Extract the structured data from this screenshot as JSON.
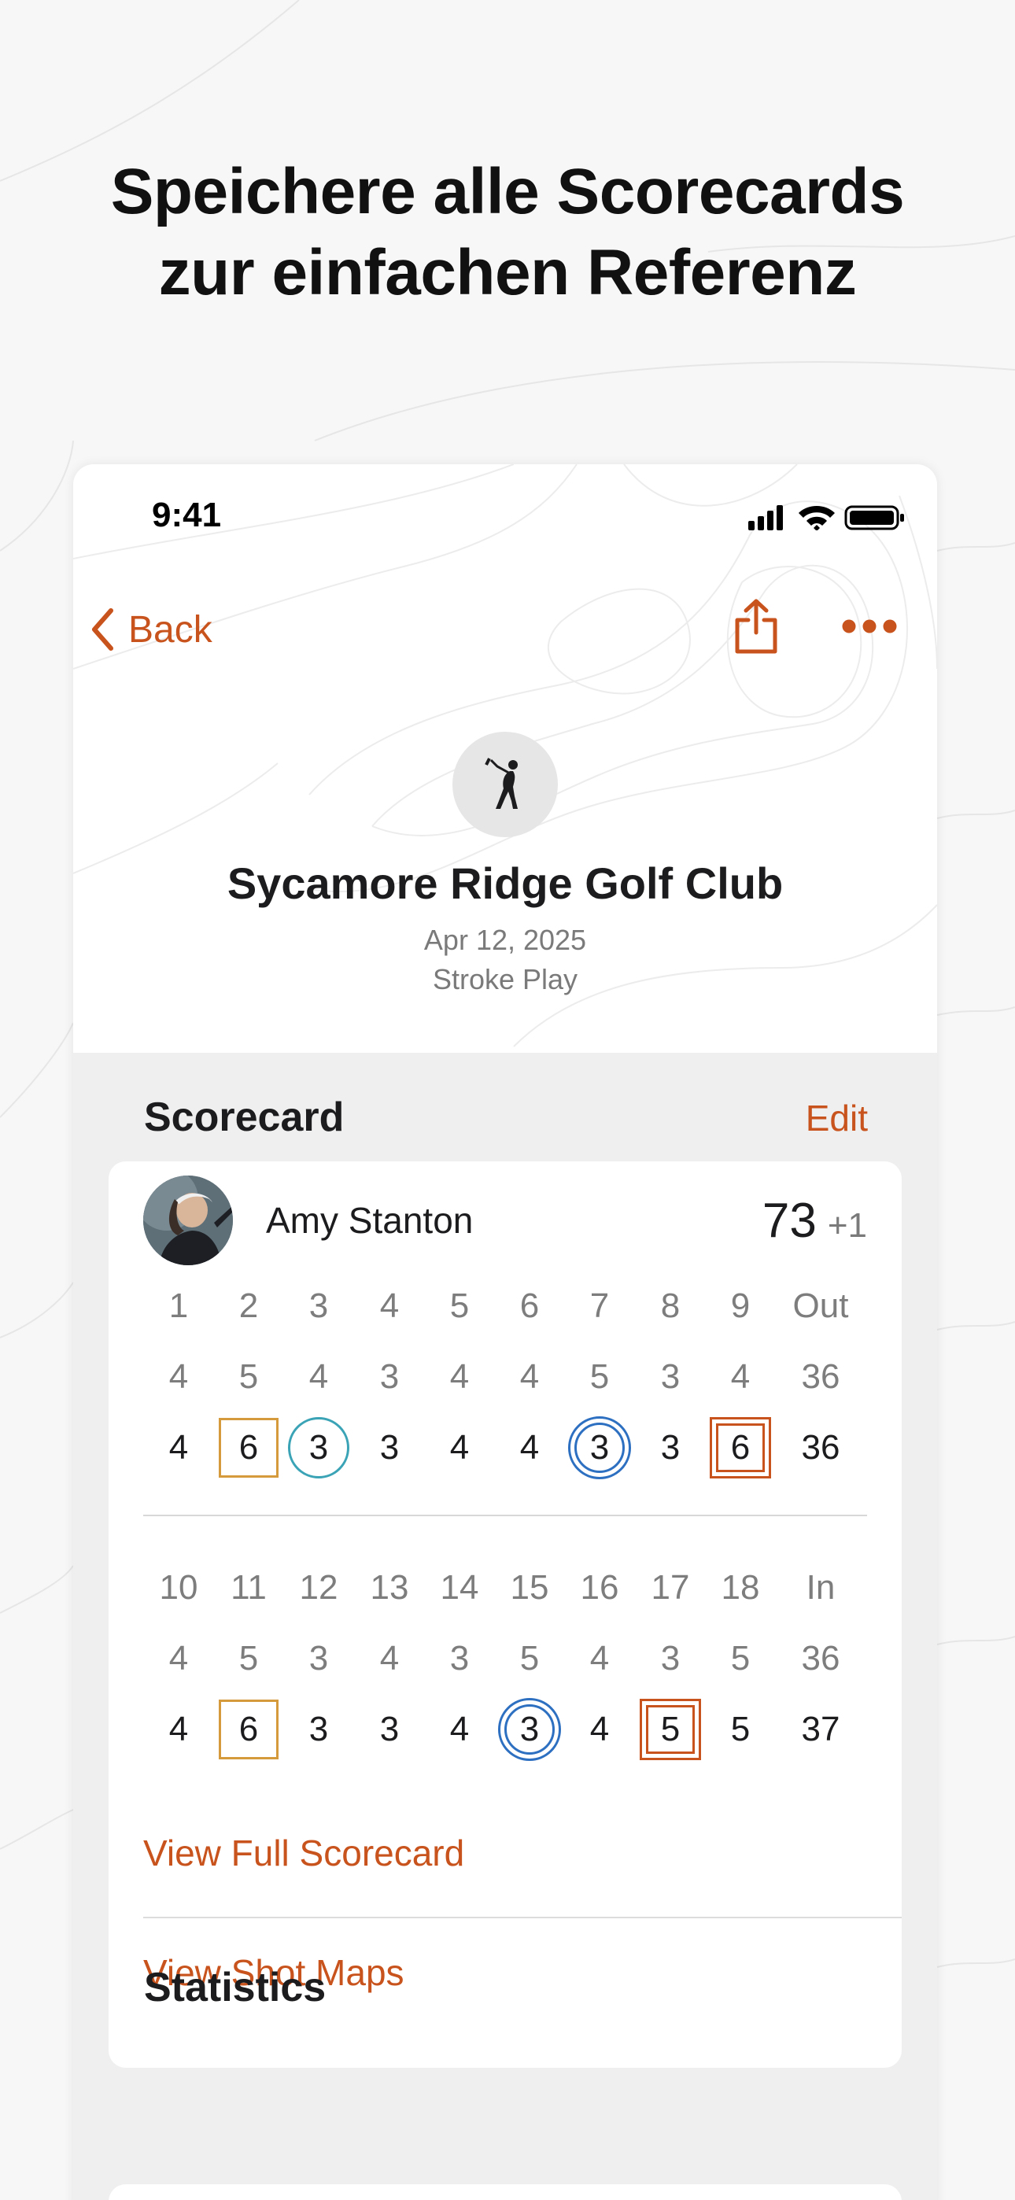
{
  "headline": {
    "line1": "Speichere alle Scorecards",
    "line2": "zur einfachen Referenz"
  },
  "status_bar": {
    "time": "9:41",
    "icons": [
      "cellular-signal-icon",
      "wifi-icon",
      "battery-icon"
    ]
  },
  "nav": {
    "back_label": "Back",
    "icons": [
      "chevron-left-icon",
      "share-icon",
      "more-icon"
    ]
  },
  "course": {
    "icon": "golfer-icon",
    "name": "Sycamore Ridge Golf Club",
    "date": "Apr 12, 2025",
    "format": "Stroke Play"
  },
  "scorecard": {
    "title": "Scorecard",
    "edit_label": "Edit",
    "player": {
      "name": "Amy Stanton",
      "total": "73",
      "relative": "+1"
    },
    "front_nine": {
      "holes": [
        "1",
        "2",
        "3",
        "4",
        "5",
        "6",
        "7",
        "8",
        "9",
        "Out"
      ],
      "par": [
        "4",
        "5",
        "4",
        "3",
        "4",
        "4",
        "5",
        "3",
        "4",
        "36"
      ],
      "scores": [
        "4",
        "6",
        "3",
        "3",
        "4",
        "4",
        "3",
        "3",
        "6",
        "36"
      ],
      "marks": [
        "none",
        "bogey",
        "birdie",
        "none",
        "none",
        "none",
        "eagle",
        "none",
        "double-bogey",
        "none"
      ]
    },
    "back_nine": {
      "holes": [
        "10",
        "11",
        "12",
        "13",
        "14",
        "15",
        "16",
        "17",
        "18",
        "In"
      ],
      "par": [
        "4",
        "5",
        "3",
        "4",
        "3",
        "5",
        "4",
        "3",
        "5",
        "36"
      ],
      "scores": [
        "4",
        "6",
        "3",
        "3",
        "4",
        "3",
        "4",
        "5",
        "5",
        "37"
      ],
      "marks": [
        "none",
        "bogey",
        "none",
        "none",
        "none",
        "eagle",
        "none",
        "double-bogey",
        "none",
        "none"
      ]
    },
    "links": {
      "full_scorecard": "View Full Scorecard",
      "shot_maps": "View Shot Maps"
    }
  },
  "statistics": {
    "title": "Statistics"
  },
  "colors": {
    "accent": "#c8531c",
    "bogey": "#d49a3c",
    "birdie": "#3aa3b5",
    "eagle": "#2d6fc0",
    "double_bogey": "#c8531c"
  }
}
